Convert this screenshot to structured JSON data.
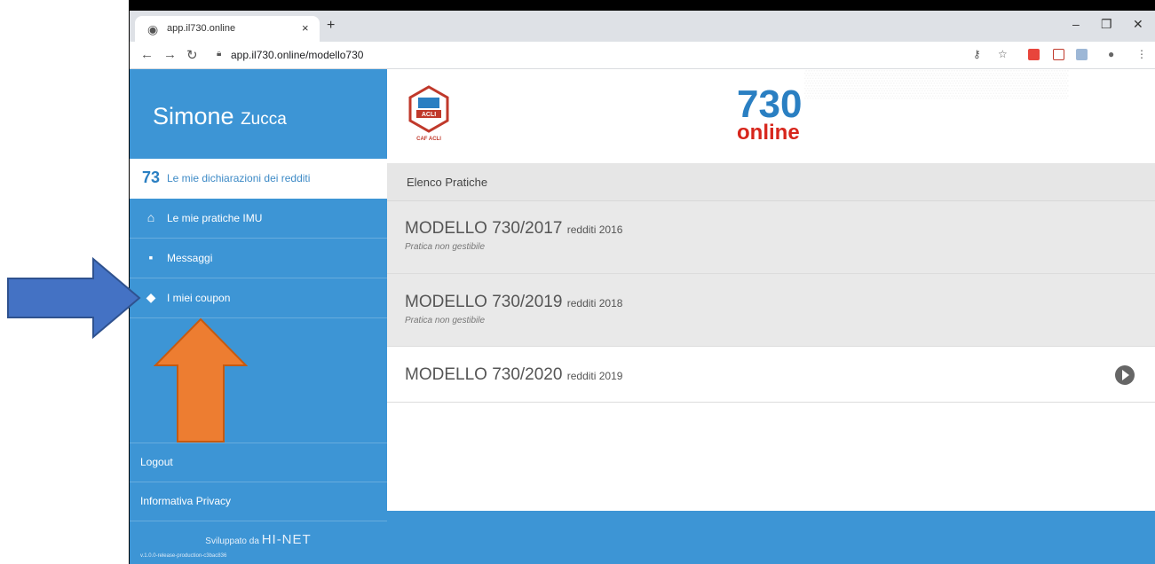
{
  "browser": {
    "tab_title": "app.il730.online",
    "tab_close": "×",
    "new_tab": "+",
    "url": "app.il730.online/modello730",
    "minimize": "–",
    "restore": "❐",
    "close": "✕"
  },
  "sidebar": {
    "user_first": "Simone",
    "user_last": "Zucca",
    "items": [
      {
        "label": "Le mie dichiarazioni dei redditi",
        "icon": "730-icon"
      },
      {
        "label": "Le mie pratiche IMU",
        "icon": "house-icon"
      },
      {
        "label": "Messaggi",
        "icon": "message-icon"
      },
      {
        "label": "I miei coupon",
        "icon": "tag-icon"
      }
    ],
    "logout": "Logout",
    "privacy": "Informativa Privacy",
    "developed_by": "Sviluppato da",
    "developer": "HI-NET",
    "version": "v.1.0.0-release-production-c3bac836"
  },
  "banner": {
    "logo_text": "ACLI",
    "logo_caption": "CAF ACLI",
    "brand_number": "730",
    "brand_word": "online"
  },
  "list": {
    "header": "Elenco Pratiche",
    "rows": [
      {
        "title": "MODELLO 730/2017",
        "subtitle": "redditi 2016",
        "note": "Pratica non gestibile"
      },
      {
        "title": "MODELLO 730/2019",
        "subtitle": "redditi 2018",
        "note": "Pratica non gestibile"
      },
      {
        "title": "MODELLO 730/2020",
        "subtitle": "redditi 2019"
      }
    ]
  },
  "colors": {
    "sidebar": "#3d95d5",
    "brand_blue": "#2a7fc2",
    "brand_red": "#d7261c",
    "arrow_blue": "#4472c4",
    "arrow_orange": "#ed7d31"
  }
}
